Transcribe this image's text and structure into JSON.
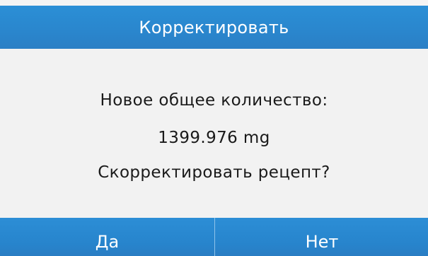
{
  "dialog": {
    "title": "Корректировать",
    "message_line1": "Новое общее количество:",
    "amount": "1399.976 mg",
    "question": "Скорректировать рецепт?"
  },
  "buttons": {
    "yes_label": "Да",
    "no_label": "Нет"
  },
  "colors": {
    "accent": "#2a86cd",
    "background": "#f2f2f2",
    "text": "#1a1a1a",
    "button_text": "#ffffff"
  }
}
